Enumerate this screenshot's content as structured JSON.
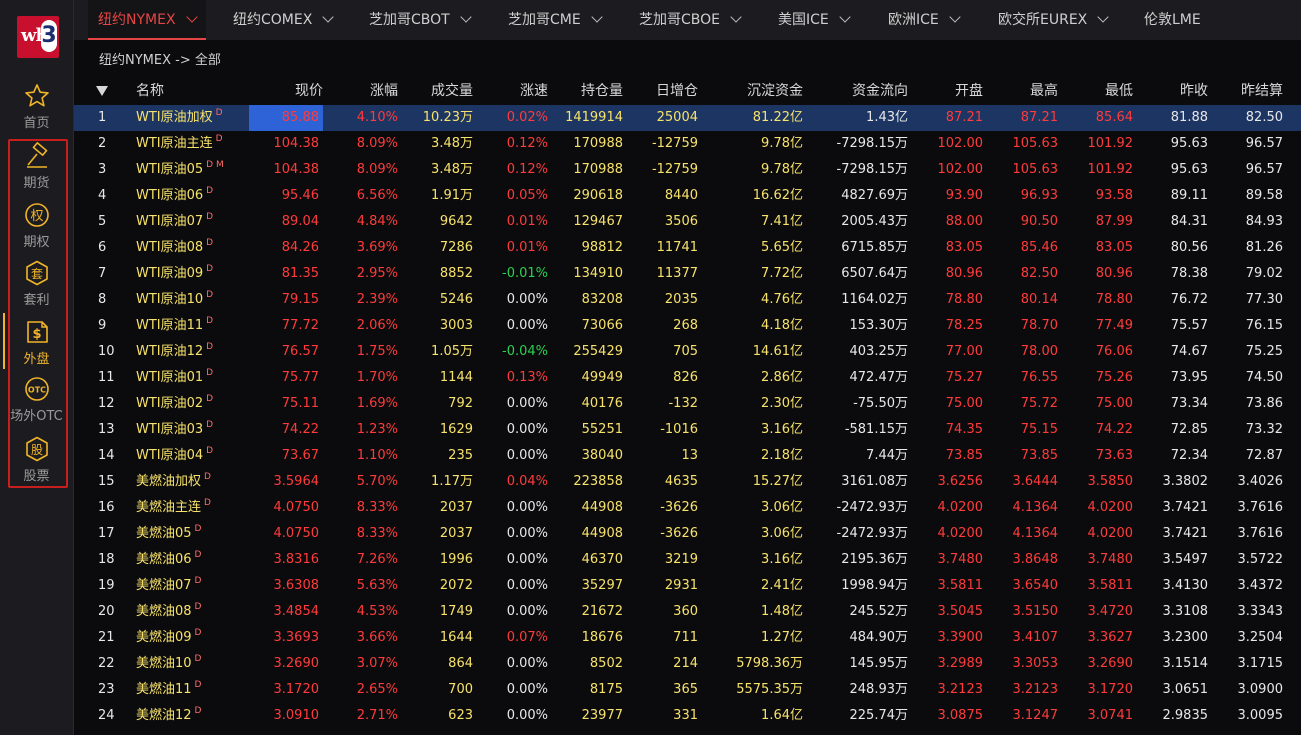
{
  "app": {
    "nav": [
      {
        "label": "首页",
        "icon": "star-icon"
      },
      {
        "label": "期货",
        "icon": "hammer-icon"
      },
      {
        "label": "期权",
        "icon": "options-icon",
        "glyph": "权"
      },
      {
        "label": "套利",
        "icon": "arbitrage-icon",
        "glyph": "套"
      },
      {
        "label": "外盘",
        "icon": "foreign-market-icon",
        "glyph": "$"
      },
      {
        "label": "场外OTC",
        "icon": "otc-icon",
        "glyph": "OTC"
      },
      {
        "label": "股票",
        "icon": "stock-icon",
        "glyph": "股"
      }
    ],
    "active_nav_index": 4
  },
  "tabs": [
    {
      "label": "纽约NYMEX",
      "active": true
    },
    {
      "label": "纽约COMEX"
    },
    {
      "label": "芝加哥CBOT"
    },
    {
      "label": "芝加哥CME"
    },
    {
      "label": "芝加哥CBOE"
    },
    {
      "label": "美国ICE"
    },
    {
      "label": "欧洲ICE"
    },
    {
      "label": "欧交所EUREX"
    },
    {
      "label": "伦敦LME"
    }
  ],
  "breadcrumb": "纽约NYMEX -> 全部",
  "table": {
    "columns": [
      "名称",
      "现价",
      "涨幅",
      "成交量",
      "涨速",
      "持仓量",
      "日增仓",
      "沉淀资金",
      "资金流向",
      "开盘",
      "最高",
      "最低",
      "昨收",
      "昨结算"
    ],
    "rows": [
      {
        "n": "1",
        "name": "WTI原油加权",
        "tag": "D",
        "price": "85.88",
        "chg": "4.10%",
        "vol": "10.23万",
        "spd": "0.02%",
        "oi": "1419914",
        "doi": "25004",
        "fund": "81.22亿",
        "flow": "1.43亿",
        "open": "87.21",
        "high": "87.21",
        "low": "85.64",
        "pc": "81.88",
        "ps": "82.50",
        "c": {
          "price": "red",
          "chg": "red",
          "spd": "red",
          "open": "red",
          "high": "red",
          "low": "red"
        }
      },
      {
        "n": "2",
        "name": "WTI原油主连",
        "tag": "D",
        "price": "104.38",
        "chg": "8.09%",
        "vol": "3.48万",
        "spd": "0.12%",
        "oi": "170988",
        "doi": "-12759",
        "fund": "9.78亿",
        "flow": "-7298.15万",
        "open": "102.00",
        "high": "105.63",
        "low": "101.92",
        "pc": "95.63",
        "ps": "96.57",
        "c": {
          "price": "red",
          "chg": "red",
          "spd": "red",
          "open": "red",
          "high": "red",
          "low": "red"
        }
      },
      {
        "n": "3",
        "name": "WTI原油05",
        "tag": "D M",
        "price": "104.38",
        "chg": "8.09%",
        "vol": "3.48万",
        "spd": "0.12%",
        "oi": "170988",
        "doi": "-12759",
        "fund": "9.78亿",
        "flow": "-7298.15万",
        "open": "102.00",
        "high": "105.63",
        "low": "101.92",
        "pc": "95.63",
        "ps": "96.57",
        "c": {
          "price": "red",
          "chg": "red",
          "spd": "red",
          "open": "red",
          "high": "red",
          "low": "red"
        }
      },
      {
        "n": "4",
        "name": "WTI原油06",
        "tag": "D",
        "price": "95.46",
        "chg": "6.56%",
        "vol": "1.91万",
        "spd": "0.05%",
        "oi": "290618",
        "doi": "8440",
        "fund": "16.62亿",
        "flow": "4827.69万",
        "open": "93.90",
        "high": "96.93",
        "low": "93.58",
        "pc": "89.11",
        "ps": "89.58",
        "c": {
          "price": "red",
          "chg": "red",
          "spd": "red",
          "open": "red",
          "high": "red",
          "low": "red"
        }
      },
      {
        "n": "5",
        "name": "WTI原油07",
        "tag": "D",
        "price": "89.04",
        "chg": "4.84%",
        "vol": "9642",
        "spd": "0.01%",
        "oi": "129467",
        "doi": "3506",
        "fund": "7.41亿",
        "flow": "2005.43万",
        "open": "88.00",
        "high": "90.50",
        "low": "87.99",
        "pc": "84.31",
        "ps": "84.93",
        "c": {
          "price": "red",
          "chg": "red",
          "spd": "red",
          "open": "red",
          "high": "red",
          "low": "red"
        }
      },
      {
        "n": "6",
        "name": "WTI原油08",
        "tag": "D",
        "price": "84.26",
        "chg": "3.69%",
        "vol": "7286",
        "spd": "0.01%",
        "oi": "98812",
        "doi": "11741",
        "fund": "5.65亿",
        "flow": "6715.85万",
        "open": "83.05",
        "high": "85.46",
        "low": "83.05",
        "pc": "80.56",
        "ps": "81.26",
        "c": {
          "price": "red",
          "chg": "red",
          "spd": "red",
          "open": "red",
          "high": "red",
          "low": "red"
        }
      },
      {
        "n": "7",
        "name": "WTI原油09",
        "tag": "D",
        "price": "81.35",
        "chg": "2.95%",
        "vol": "8852",
        "spd": "-0.01%",
        "oi": "134910",
        "doi": "11377",
        "fund": "7.72亿",
        "flow": "6507.64万",
        "open": "80.96",
        "high": "82.50",
        "low": "80.96",
        "pc": "78.38",
        "ps": "79.02",
        "c": {
          "price": "red",
          "chg": "red",
          "spd": "green",
          "open": "red",
          "high": "red",
          "low": "red"
        }
      },
      {
        "n": "8",
        "name": "WTI原油10",
        "tag": "D",
        "price": "79.15",
        "chg": "2.39%",
        "vol": "5246",
        "spd": "0.00%",
        "oi": "83208",
        "doi": "2035",
        "fund": "4.76亿",
        "flow": "1164.02万",
        "open": "78.80",
        "high": "80.14",
        "low": "78.80",
        "pc": "76.72",
        "ps": "77.30",
        "c": {
          "price": "red",
          "chg": "red",
          "spd": "white",
          "open": "red",
          "high": "red",
          "low": "red"
        }
      },
      {
        "n": "9",
        "name": "WTI原油11",
        "tag": "D",
        "price": "77.72",
        "chg": "2.06%",
        "vol": "3003",
        "spd": "0.00%",
        "oi": "73066",
        "doi": "268",
        "fund": "4.18亿",
        "flow": "153.30万",
        "open": "78.25",
        "high": "78.70",
        "low": "77.49",
        "pc": "75.57",
        "ps": "76.15",
        "c": {
          "price": "red",
          "chg": "red",
          "spd": "white",
          "open": "red",
          "high": "red",
          "low": "red"
        }
      },
      {
        "n": "10",
        "name": "WTI原油12",
        "tag": "D",
        "price": "76.57",
        "chg": "1.75%",
        "vol": "1.05万",
        "spd": "-0.04%",
        "oi": "255429",
        "doi": "705",
        "fund": "14.61亿",
        "flow": "403.25万",
        "open": "77.00",
        "high": "78.00",
        "low": "76.06",
        "pc": "74.67",
        "ps": "75.25",
        "c": {
          "price": "red",
          "chg": "red",
          "spd": "green",
          "open": "red",
          "high": "red",
          "low": "red"
        }
      },
      {
        "n": "11",
        "name": "WTI原油01",
        "tag": "D",
        "price": "75.77",
        "chg": "1.70%",
        "vol": "1144",
        "spd": "0.13%",
        "oi": "49949",
        "doi": "826",
        "fund": "2.86亿",
        "flow": "472.47万",
        "open": "75.27",
        "high": "76.55",
        "low": "75.26",
        "pc": "73.95",
        "ps": "74.50",
        "c": {
          "price": "red",
          "chg": "red",
          "spd": "red",
          "open": "red",
          "high": "red",
          "low": "red"
        }
      },
      {
        "n": "12",
        "name": "WTI原油02",
        "tag": "D",
        "price": "75.11",
        "chg": "1.69%",
        "vol": "792",
        "spd": "0.00%",
        "oi": "40176",
        "doi": "-132",
        "fund": "2.30亿",
        "flow": "-75.50万",
        "open": "75.00",
        "high": "75.72",
        "low": "75.00",
        "pc": "73.34",
        "ps": "73.86",
        "c": {
          "price": "red",
          "chg": "red",
          "spd": "white",
          "open": "red",
          "high": "red",
          "low": "red"
        }
      },
      {
        "n": "13",
        "name": "WTI原油03",
        "tag": "D",
        "price": "74.22",
        "chg": "1.23%",
        "vol": "1629",
        "spd": "0.00%",
        "oi": "55251",
        "doi": "-1016",
        "fund": "3.16亿",
        "flow": "-581.15万",
        "open": "74.35",
        "high": "75.15",
        "low": "74.22",
        "pc": "72.85",
        "ps": "73.32",
        "c": {
          "price": "red",
          "chg": "red",
          "spd": "white",
          "open": "red",
          "high": "red",
          "low": "red"
        }
      },
      {
        "n": "14",
        "name": "WTI原油04",
        "tag": "D",
        "price": "73.67",
        "chg": "1.10%",
        "vol": "235",
        "spd": "0.00%",
        "oi": "38040",
        "doi": "13",
        "fund": "2.18亿",
        "flow": "7.44万",
        "open": "73.85",
        "high": "73.85",
        "low": "73.63",
        "pc": "72.34",
        "ps": "72.87",
        "c": {
          "price": "red",
          "chg": "red",
          "spd": "white",
          "open": "red",
          "high": "red",
          "low": "red"
        }
      },
      {
        "n": "15",
        "name": "美燃油加权",
        "tag": "D",
        "price": "3.5964",
        "chg": "5.70%",
        "vol": "1.17万",
        "spd": "0.04%",
        "oi": "223858",
        "doi": "4635",
        "fund": "15.27亿",
        "flow": "3161.08万",
        "open": "3.6256",
        "high": "3.6444",
        "low": "3.5850",
        "pc": "3.3802",
        "ps": "3.4026",
        "c": {
          "price": "red",
          "chg": "red",
          "spd": "red",
          "open": "red",
          "high": "red",
          "low": "red"
        }
      },
      {
        "n": "16",
        "name": "美燃油主连",
        "tag": "D",
        "price": "4.0750",
        "chg": "8.33%",
        "vol": "2037",
        "spd": "0.00%",
        "oi": "44908",
        "doi": "-3626",
        "fund": "3.06亿",
        "flow": "-2472.93万",
        "open": "4.0200",
        "high": "4.1364",
        "low": "4.0200",
        "pc": "3.7421",
        "ps": "3.7616",
        "c": {
          "price": "red",
          "chg": "red",
          "spd": "white",
          "open": "red",
          "high": "red",
          "low": "red"
        }
      },
      {
        "n": "17",
        "name": "美燃油05",
        "tag": "D",
        "price": "4.0750",
        "chg": "8.33%",
        "vol": "2037",
        "spd": "0.00%",
        "oi": "44908",
        "doi": "-3626",
        "fund": "3.06亿",
        "flow": "-2472.93万",
        "open": "4.0200",
        "high": "4.1364",
        "low": "4.0200",
        "pc": "3.7421",
        "ps": "3.7616",
        "c": {
          "price": "red",
          "chg": "red",
          "spd": "white",
          "open": "red",
          "high": "red",
          "low": "red"
        }
      },
      {
        "n": "18",
        "name": "美燃油06",
        "tag": "D",
        "price": "3.8316",
        "chg": "7.26%",
        "vol": "1996",
        "spd": "0.00%",
        "oi": "46370",
        "doi": "3219",
        "fund": "3.16亿",
        "flow": "2195.36万",
        "open": "3.7480",
        "high": "3.8648",
        "low": "3.7480",
        "pc": "3.5497",
        "ps": "3.5722",
        "c": {
          "price": "red",
          "chg": "red",
          "spd": "white",
          "open": "red",
          "high": "red",
          "low": "red"
        }
      },
      {
        "n": "19",
        "name": "美燃油07",
        "tag": "D",
        "price": "3.6308",
        "chg": "5.63%",
        "vol": "2072",
        "spd": "0.00%",
        "oi": "35297",
        "doi": "2931",
        "fund": "2.41亿",
        "flow": "1998.94万",
        "open": "3.5811",
        "high": "3.6540",
        "low": "3.5811",
        "pc": "3.4130",
        "ps": "3.4372",
        "c": {
          "price": "red",
          "chg": "red",
          "spd": "white",
          "open": "red",
          "high": "red",
          "low": "red"
        }
      },
      {
        "n": "20",
        "name": "美燃油08",
        "tag": "D",
        "price": "3.4854",
        "chg": "4.53%",
        "vol": "1749",
        "spd": "0.00%",
        "oi": "21672",
        "doi": "360",
        "fund": "1.48亿",
        "flow": "245.52万",
        "open": "3.5045",
        "high": "3.5150",
        "low": "3.4720",
        "pc": "3.3108",
        "ps": "3.3343",
        "c": {
          "price": "red",
          "chg": "red",
          "spd": "white",
          "open": "red",
          "high": "red",
          "low": "red"
        }
      },
      {
        "n": "21",
        "name": "美燃油09",
        "tag": "D",
        "price": "3.3693",
        "chg": "3.66%",
        "vol": "1644",
        "spd": "0.07%",
        "oi": "18676",
        "doi": "711",
        "fund": "1.27亿",
        "flow": "484.90万",
        "open": "3.3900",
        "high": "3.4107",
        "low": "3.3627",
        "pc": "3.2300",
        "ps": "3.2504",
        "c": {
          "price": "red",
          "chg": "red",
          "spd": "red",
          "open": "red",
          "high": "red",
          "low": "red"
        }
      },
      {
        "n": "22",
        "name": "美燃油10",
        "tag": "D",
        "price": "3.2690",
        "chg": "3.07%",
        "vol": "864",
        "spd": "0.00%",
        "oi": "8502",
        "doi": "214",
        "fund": "5798.36万",
        "flow": "145.95万",
        "open": "3.2989",
        "high": "3.3053",
        "low": "3.2690",
        "pc": "3.1514",
        "ps": "3.1715",
        "c": {
          "price": "red",
          "chg": "red",
          "spd": "white",
          "open": "red",
          "high": "red",
          "low": "red"
        }
      },
      {
        "n": "23",
        "name": "美燃油11",
        "tag": "D",
        "price": "3.1720",
        "chg": "2.65%",
        "vol": "700",
        "spd": "0.00%",
        "oi": "8175",
        "doi": "365",
        "fund": "5575.35万",
        "flow": "248.93万",
        "open": "3.2123",
        "high": "3.2123",
        "low": "3.1720",
        "pc": "3.0651",
        "ps": "3.0900",
        "c": {
          "price": "red",
          "chg": "red",
          "spd": "white",
          "open": "red",
          "high": "red",
          "low": "red"
        }
      },
      {
        "n": "24",
        "name": "美燃油12",
        "tag": "D",
        "price": "3.0910",
        "chg": "2.71%",
        "vol": "623",
        "spd": "0.00%",
        "oi": "23977",
        "doi": "331",
        "fund": "1.64亿",
        "flow": "225.74万",
        "open": "3.0875",
        "high": "3.1247",
        "low": "3.0741",
        "pc": "2.9835",
        "ps": "3.0095",
        "c": {
          "price": "red",
          "chg": "red",
          "spd": "white",
          "open": "red",
          "high": "red",
          "low": "red"
        }
      }
    ]
  },
  "colors": {
    "up": "#ff3b3b",
    "down": "#29d14f",
    "name": "#f7e26b",
    "accent": "#f0b429",
    "tab_active": "#e54545",
    "selected_row": "#1d3563"
  }
}
